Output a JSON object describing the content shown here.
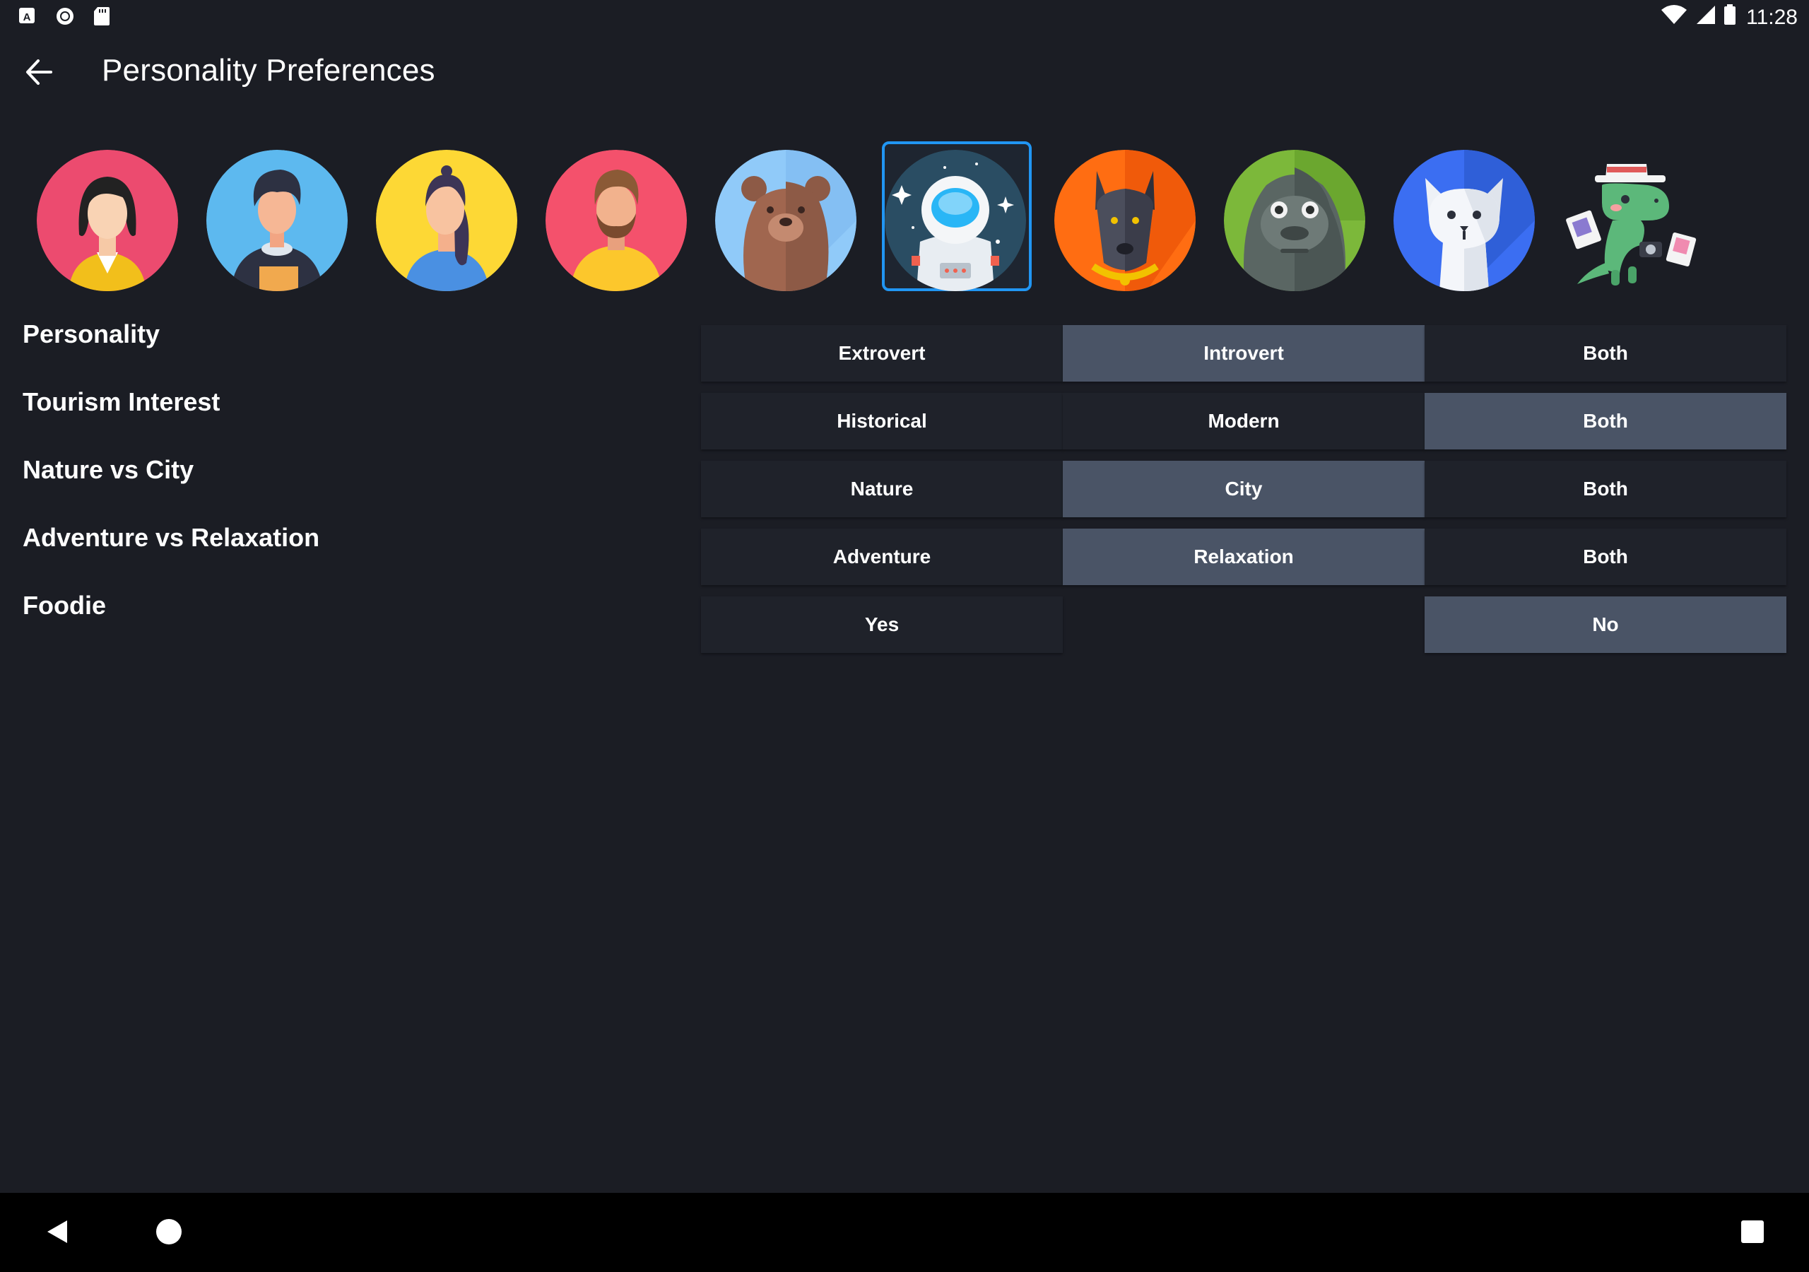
{
  "status_bar": {
    "time": "11:28",
    "left_icons": [
      "a-letter-icon",
      "circle-record-icon",
      "sd-card-icon"
    ],
    "right_icons": [
      "wifi-icon",
      "cellular-signal-icon",
      "battery-icon"
    ]
  },
  "app_bar": {
    "title": "Personality Preferences",
    "back_icon": "arrow-left-icon"
  },
  "avatars": [
    {
      "name": "woman-black-hair-avatar",
      "bg": "#ec4b6f"
    },
    {
      "name": "man-dark-hoodie-avatar",
      "bg": "#5db9ef"
    },
    {
      "name": "woman-ponytail-avatar",
      "bg": "#fdd835"
    },
    {
      "name": "man-beard-avatar",
      "bg": "#f4516c"
    },
    {
      "name": "bear-avatar",
      "bg": "#90caf9"
    },
    {
      "name": "astronaut-avatar",
      "bg": "#2a4d63",
      "selected": true
    },
    {
      "name": "dog-avatar",
      "bg": "#ff6d12"
    },
    {
      "name": "gorilla-avatar",
      "bg": "#7cb83a"
    },
    {
      "name": "white-cat-avatar",
      "bg": "#3b6ef2"
    },
    {
      "name": "dinosaur-tourist-avatar",
      "bg": "transparent"
    }
  ],
  "preferences": [
    {
      "label": "Personality",
      "options": [
        "Extrovert",
        "Introvert",
        "Both"
      ],
      "selected": 1
    },
    {
      "label": "Tourism Interest",
      "options": [
        "Historical",
        "Modern",
        "Both"
      ],
      "selected": 2
    },
    {
      "label": "Nature vs City",
      "options": [
        "Nature",
        "City",
        "Both"
      ],
      "selected": 1
    },
    {
      "label": "Adventure vs Relaxation",
      "options": [
        "Adventure",
        "Relaxation",
        "Both"
      ],
      "selected": 1
    },
    {
      "label": "Foodie",
      "options": [
        "Yes",
        "",
        "No"
      ],
      "selected": 2
    }
  ],
  "colors": {
    "background": "#1b1d24",
    "option_bg": "#1f222a",
    "option_selected_bg": "#4a5466",
    "selection_accent": "#2196f3",
    "nav_bar": "#000000"
  },
  "nav_bar": {
    "icons": [
      "back-triangle-icon",
      "home-circle-icon",
      "recents-square-icon"
    ]
  }
}
